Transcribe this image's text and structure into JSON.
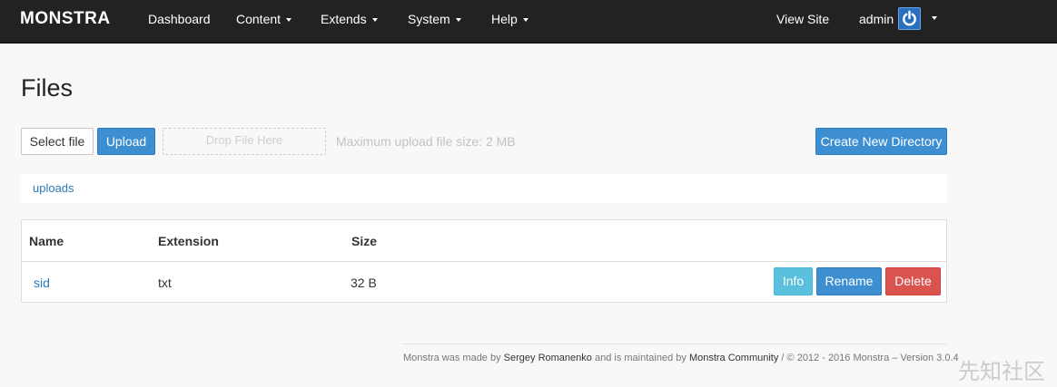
{
  "navbar": {
    "brand": "MONSTRA",
    "items": [
      {
        "label": "Dashboard"
      },
      {
        "label": "Content"
      },
      {
        "label": "Extends"
      },
      {
        "label": "System"
      },
      {
        "label": "Help"
      }
    ],
    "view_site": "View Site",
    "user": "admin",
    "power_icon": "power-icon"
  },
  "page": {
    "title": "Files",
    "select_file": "Select file",
    "upload": "Upload",
    "dropzone": "Drop File Here",
    "max_upload": "Maximum upload file size: 2 MB",
    "create_dir": "Create New Directory"
  },
  "breadcrumb": {
    "items": [
      "uploads"
    ]
  },
  "table": {
    "columns": [
      "Name",
      "Extension",
      "Size"
    ],
    "rows": [
      {
        "name": "sid",
        "extension": "txt",
        "size": "32 B",
        "actions": [
          "Info",
          "Rename",
          "Delete"
        ]
      }
    ]
  },
  "footer": {
    "made_by_prefix": "Monstra was made by",
    "author": "Sergey Romanenko",
    "maintained_prefix": "and is maintained by",
    "community": "Monstra Community",
    "suffix": "/ © 2012 - 2016 Monstra – Version 3.0.4"
  },
  "watermark": "先知社区",
  "colors": {
    "navbar_bg": "#222222",
    "primary": "#3d8fd1",
    "info": "#5bc0de",
    "danger": "#d9534f",
    "link": "#2a7ab8"
  }
}
